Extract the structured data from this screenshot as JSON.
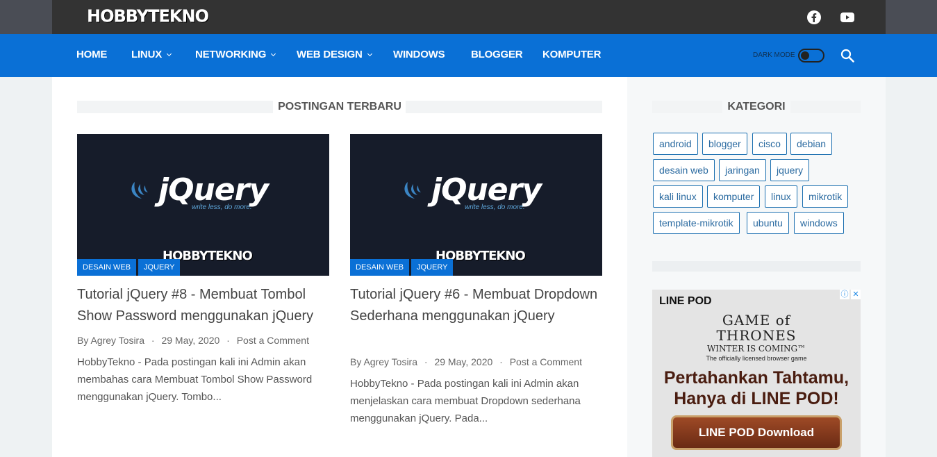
{
  "site": {
    "logo": "HOBBYTEKNO"
  },
  "nav": {
    "items": [
      {
        "label": "HOME",
        "dropdown": false
      },
      {
        "label": "LINUX",
        "dropdown": true
      },
      {
        "label": "NETWORKING",
        "dropdown": true
      },
      {
        "label": "WEB DESIGN",
        "dropdown": true
      },
      {
        "label": "WINDOWS",
        "dropdown": false
      },
      {
        "label": "BLOGGER",
        "dropdown": false
      },
      {
        "label": "KOMPUTER",
        "dropdown": false
      }
    ],
    "dark_mode_label": "DARK MODE"
  },
  "main": {
    "section_title": "POSTINGAN TERBARU",
    "posts": [
      {
        "thumb_logo": "jQuery",
        "thumb_tagline": "write less, do more.",
        "thumb_brand": "HOBBYTEKNO",
        "tags": [
          "DESAIN WEB",
          "JQUERY"
        ],
        "title": "Tutorial jQuery #8 - Membuat Tombol Show Password menggunakan jQuery",
        "author": "By Agrey Tosira",
        "date": "29 May, 2020",
        "comment": "Post a Comment",
        "excerpt": "HobbyTekno  - Pada postingan kali ini Admin akan membahas cara Membuat Tombol Show Password menggunakan jQuery. Tombo..."
      },
      {
        "thumb_logo": "jQuery",
        "thumb_tagline": "write less, do more.",
        "thumb_brand": "HOBBYTEKNO",
        "tags": [
          "DESAIN WEB",
          "JQUERY"
        ],
        "title": "Tutorial jQuery #6 - Membuat Dropdown Sederhana menggunakan jQuery",
        "author": "By Agrey Tosira",
        "date": "29 May, 2020",
        "comment": "Post a Comment",
        "excerpt": "HobbyTekno  - Pada postingan kali ini Admin akan menjelaskan cara membuat Dropdown sederhana menggunakan jQuery. Pada..."
      }
    ]
  },
  "sidebar": {
    "title": "KATEGORI",
    "categories": [
      "android",
      "blogger",
      "cisco",
      "debian",
      "desain web",
      "jaringan",
      "jquery",
      "kali linux",
      "komputer",
      "linux",
      "mikrotik",
      "template-mikrotik",
      "ubuntu",
      "windows"
    ]
  },
  "ad": {
    "brand": "LINE POD",
    "game_line1": "GAME of",
    "game_line2": "THRONES",
    "game_line3": "WINTER IS COMING™",
    "licensed": "The officially licensed browser game",
    "headline1": "Pertahankan Tahtamu,",
    "headline2": "Hanya di LINE POD!",
    "button": "LINE POD Download"
  },
  "colors": {
    "nav_blue": "#0a70d6",
    "topbar": "#333333",
    "tag_blue": "#0a70d6"
  },
  "icons": [
    "facebook-icon",
    "youtube-icon",
    "search-icon",
    "chevron-down-icon",
    "ad-info-icon",
    "ad-close-icon"
  ]
}
